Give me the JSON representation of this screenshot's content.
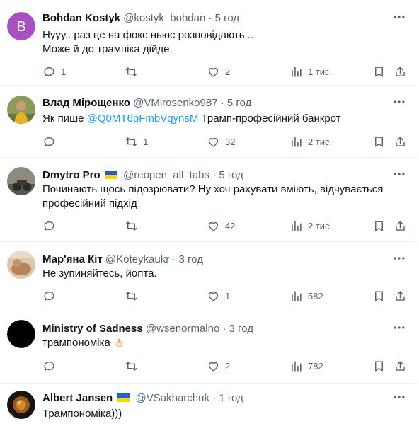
{
  "tweets": [
    {
      "name": "Bohdan Kostyk",
      "handle": "@kostyk_bohdan",
      "time": "5 год",
      "flag": false,
      "avatar_letter": "B",
      "avatar_color": "#a84fc2",
      "text_lines": [
        "Нууу.. раз це на фокс ньюс розповідають...",
        "Може й до трампіка дійде."
      ],
      "replies": "1",
      "retweets": "",
      "likes": "2",
      "views": "1 тис."
    },
    {
      "name": "Влад Мірощенко",
      "handle": "@VMirosenko987",
      "time": "5 год",
      "flag": false,
      "text_prefix": "Як пише ",
      "mention": "@Q0MT6pFmbVqynsM",
      "text_suffix": " Трамп-професійний банкрот",
      "replies": "",
      "retweets": "1",
      "likes": "32",
      "views": "2 тис."
    },
    {
      "name": "Dmytro Pro",
      "handle": "@reopen_all_tabs",
      "time": "5 год",
      "flag": true,
      "text_lines": [
        "Починають щось підозрювати? Ну хоч рахувати вміють, відчувається",
        "професійний підхід"
      ],
      "replies": "",
      "retweets": "",
      "likes": "42",
      "views": "2 тис."
    },
    {
      "name": "Мар'яна Кіт",
      "handle": "@Koteykaukr",
      "time": "3 год",
      "flag": false,
      "text_lines": [
        "Не зупиняйтесь, йопта."
      ],
      "replies": "",
      "retweets": "",
      "likes": "1",
      "views": "582"
    },
    {
      "name": "Ministry of Sadness",
      "handle": "@wsenormalno",
      "time": "3 год",
      "flag": false,
      "text_lines": [
        "трампономіка"
      ],
      "emoji": "👌🏻",
      "replies": "",
      "retweets": "",
      "likes": "2",
      "views": "782"
    },
    {
      "name": "Albert Jansen",
      "handle": "@VSakharchuk",
      "time": "1 год",
      "flag": true,
      "text_lines": [
        "Трампономіка)))"
      ],
      "replies": "",
      "retweets": "",
      "likes": "",
      "views": ""
    }
  ],
  "separator": "·",
  "colors": {
    "text": "#0f1419",
    "secondary": "#536471",
    "link": "#1d9bf0",
    "flag_blue": "#1f5fd1",
    "flag_yellow": "#ffd500"
  },
  "icons": [
    "more-icon",
    "reply-icon",
    "retweet-icon",
    "like-icon",
    "views-icon",
    "bookmark-icon",
    "share-icon"
  ]
}
